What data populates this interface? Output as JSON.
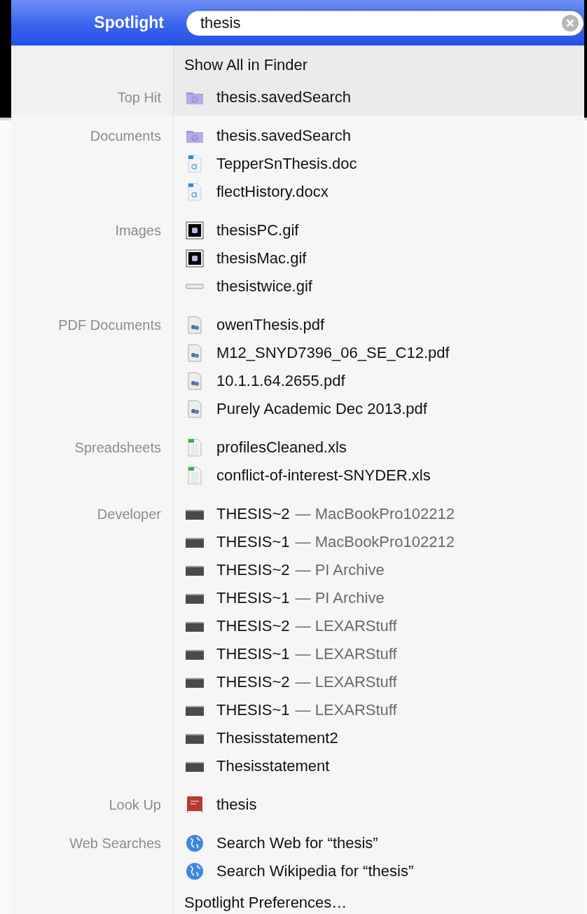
{
  "header": {
    "title": "Spotlight",
    "query": "thesis"
  },
  "top": {
    "show_all": "Show All in Finder",
    "label": "Top Hit",
    "item": {
      "kind": "saved-search",
      "name": "thesis.savedSearch"
    }
  },
  "sections": [
    {
      "label": "Documents",
      "items": [
        {
          "kind": "saved-search",
          "name": "thesis.savedSearch"
        },
        {
          "kind": "document",
          "name": "TepperSnThesis.doc"
        },
        {
          "kind": "document",
          "name": "flectHistory.docx"
        }
      ]
    },
    {
      "label": "Images",
      "items": [
        {
          "kind": "image",
          "name": "thesisPC.gif"
        },
        {
          "kind": "image",
          "name": "thesisMac.gif"
        },
        {
          "kind": "image-strip",
          "name": "thesistwice.gif"
        }
      ]
    },
    {
      "label": "PDF Documents",
      "items": [
        {
          "kind": "pdf",
          "name": "owenThesis.pdf"
        },
        {
          "kind": "pdf",
          "name": "M12_SNYD7396_06_SE_C12.pdf"
        },
        {
          "kind": "pdf",
          "name": "10.1.1.64.2655.pdf"
        },
        {
          "kind": "pdf",
          "name": "Purely Academic Dec 2013.pdf"
        }
      ]
    },
    {
      "label": "Spreadsheets",
      "items": [
        {
          "kind": "spreadsheet",
          "name": "profilesCleaned.xls"
        },
        {
          "kind": "spreadsheet",
          "name": "conflict-of-interest-SNYDER.xls"
        }
      ]
    },
    {
      "label": "Developer",
      "items": [
        {
          "kind": "terminal",
          "name": "THESIS~2",
          "detail": "— MacBookPro102212"
        },
        {
          "kind": "terminal",
          "name": "THESIS~1",
          "detail": "— MacBookPro102212"
        },
        {
          "kind": "terminal",
          "name": "THESIS~2",
          "detail": "— PI Archive"
        },
        {
          "kind": "terminal",
          "name": "THESIS~1",
          "detail": "— PI Archive"
        },
        {
          "kind": "terminal",
          "name": "THESIS~2",
          "detail": "— LEXARStuff"
        },
        {
          "kind": "terminal",
          "name": "THESIS~1",
          "detail": "— LEXARStuff"
        },
        {
          "kind": "terminal",
          "name": "THESIS~2",
          "detail": "— LEXARStuff"
        },
        {
          "kind": "terminal",
          "name": "THESIS~1",
          "detail": "— LEXARStuff"
        },
        {
          "kind": "terminal",
          "name": "Thesisstatement2"
        },
        {
          "kind": "terminal",
          "name": "Thesisstatement"
        }
      ]
    },
    {
      "label": "Look Up",
      "items": [
        {
          "kind": "dictionary",
          "name": "thesis"
        }
      ]
    },
    {
      "label": "Web Searches",
      "items": [
        {
          "kind": "globe",
          "name": "Search Web for “thesis”"
        },
        {
          "kind": "globe",
          "name": "Search Wikipedia for “thesis”"
        }
      ]
    }
  ],
  "footer": "Spotlight Preferences…"
}
